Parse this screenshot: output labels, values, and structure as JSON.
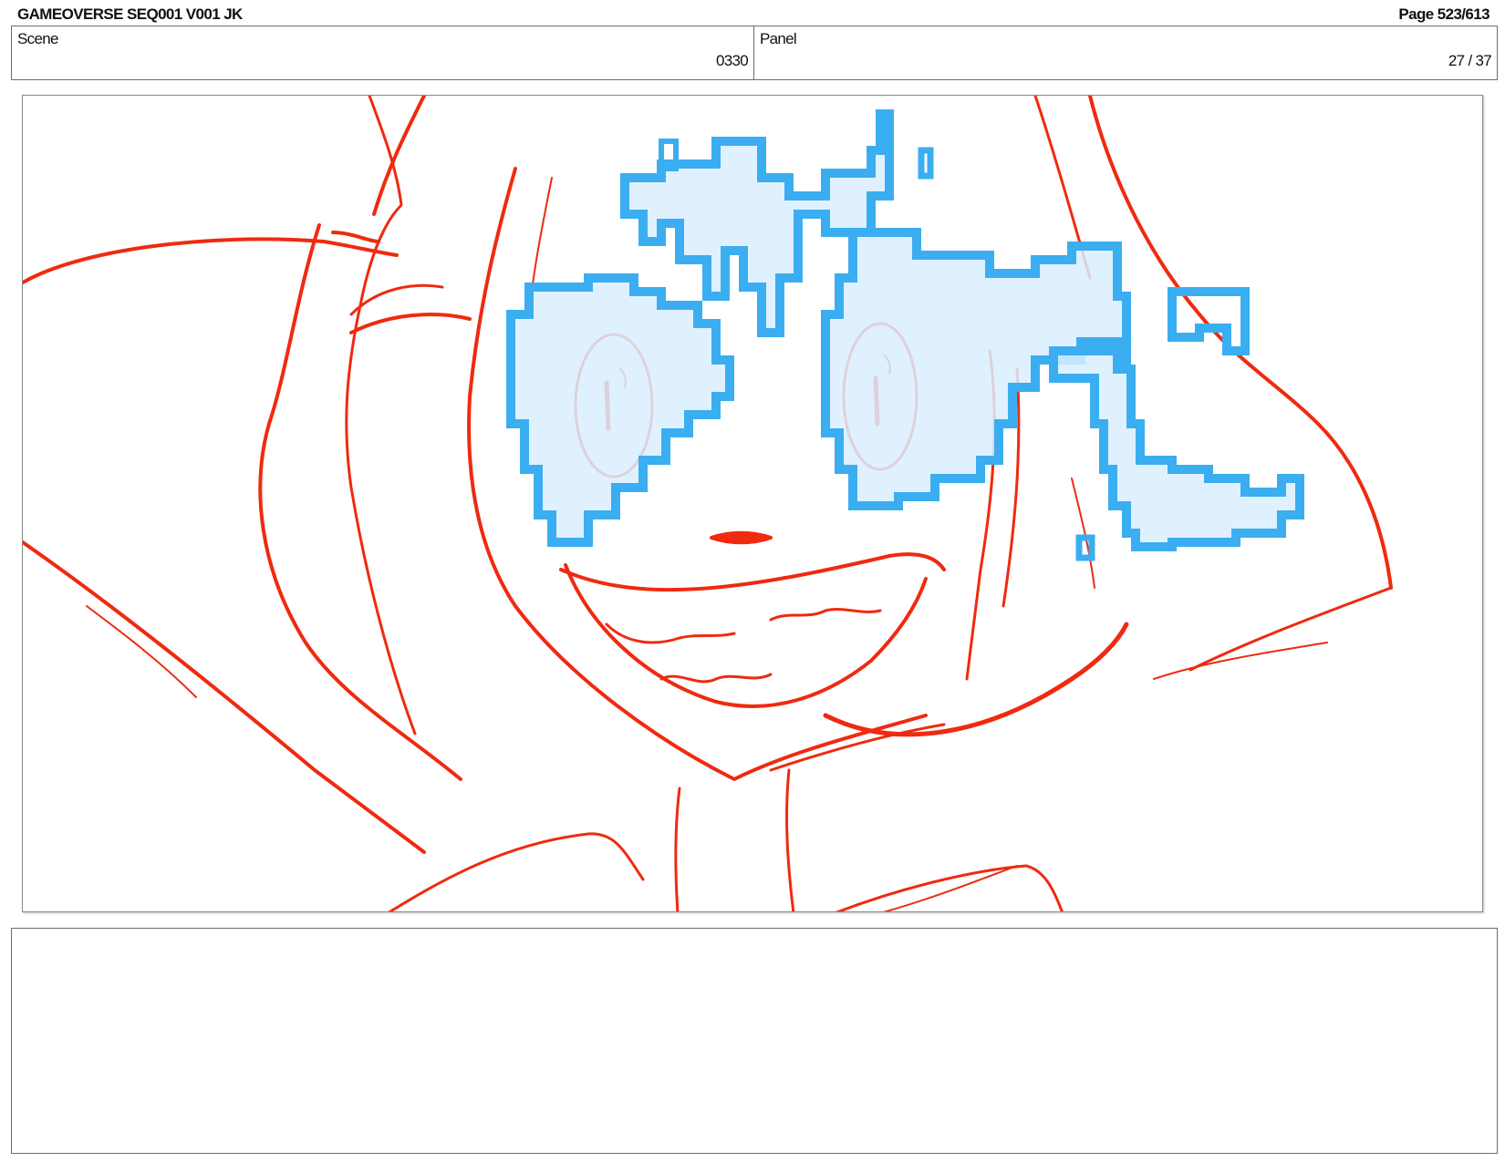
{
  "header": {
    "title": "GAMEOVERSE SEQ001 V001 JK",
    "page": "Page 523/613"
  },
  "info": {
    "scene_label": "Scene",
    "scene_value": "0330",
    "panel_label": "Panel",
    "panel_value": "27 / 37"
  },
  "notes": {
    "text": ""
  },
  "colors": {
    "sketch_line": "#ef2a10",
    "glitch_stroke": "#3aaef0",
    "glitch_fill": "#d9efff",
    "border": "#6d6d6d"
  }
}
